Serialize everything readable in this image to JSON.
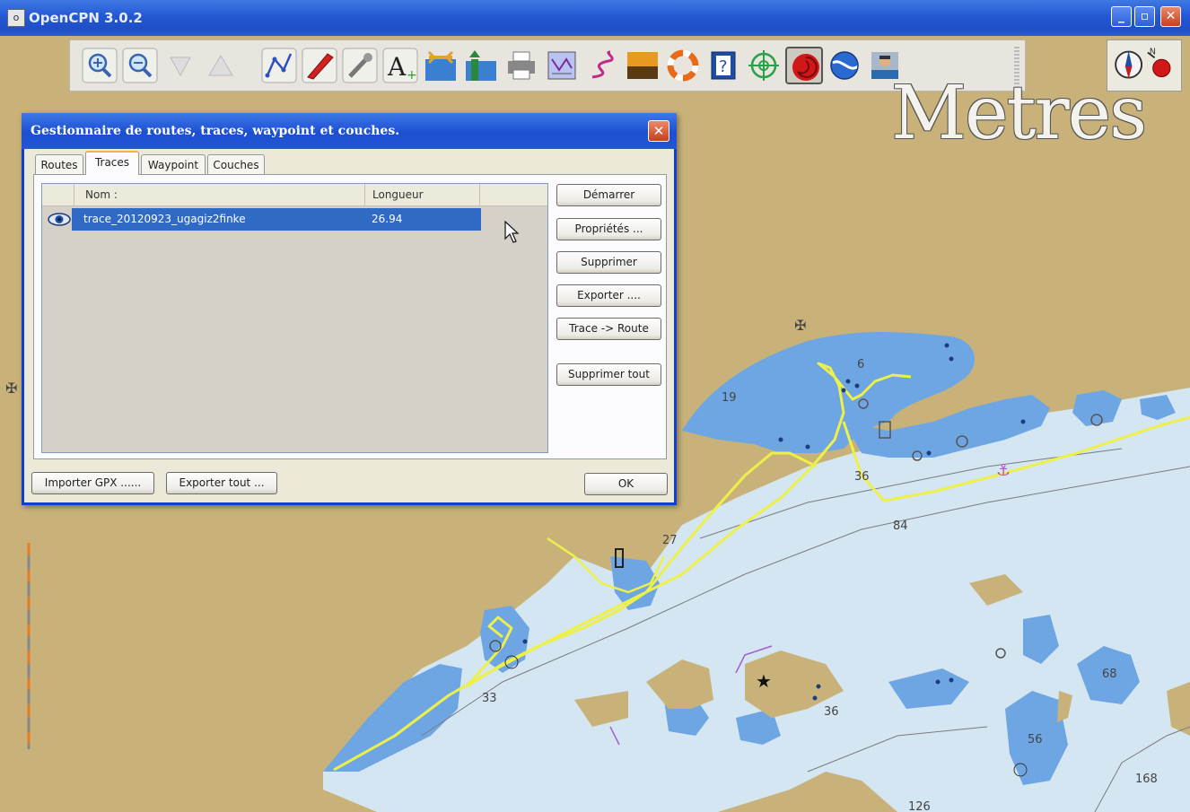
{
  "window": {
    "title": "OpenCPN 3.0.2",
    "minimize": "_",
    "maximize": "▫",
    "close": "✕"
  },
  "toolbar": {
    "tools": [
      "zoom-in-icon",
      "zoom-out-icon",
      "scale-in-icon",
      "scale-out-icon",
      "route-icon",
      "ship-follow-icon",
      "settings-wrench-icon",
      "text-icon",
      "chart-quilt-icon",
      "tide-current-icon",
      "print-icon",
      "route-manager-icon",
      "track-icon",
      "day-night-icon",
      "lifebuoy-icon",
      "about-icon",
      "mob-icon",
      "record-track-icon",
      "globe-icon",
      "pirate-icon"
    ],
    "active_tool": "record-track-icon"
  },
  "map": {
    "scale_unit_text": "Metres",
    "soundings": [
      "6",
      "19",
      "36",
      "84",
      "27",
      "33",
      "36",
      "68",
      "56",
      "168",
      "126"
    ]
  },
  "dialog": {
    "title": "Gestionnaire de routes, traces, waypoint et couches.",
    "close": "✕",
    "tabs": [
      "Routes",
      "Traces",
      "Waypoint",
      "Couches"
    ],
    "selected_tab": "Traces",
    "columns": {
      "name": "Nom :",
      "length": "Longueur"
    },
    "rows": [
      {
        "name": "trace_20120923_ugagiz2finke",
        "length": "26.94",
        "visible": true,
        "selected": true
      }
    ],
    "side_buttons": {
      "start": "Démarrer",
      "properties": "Propriétés ...",
      "delete": "Supprimer",
      "export": "Exporter ....",
      "to_route": "Trace -> Route",
      "delete_all": "Supprimer tout"
    },
    "bottom_buttons": {
      "import_gpx": "Importer GPX ......",
      "export_all": "Exporter tout ...",
      "ok": "OK"
    }
  },
  "colors": {
    "land": "#c9b27a",
    "shallow_water": "#d4e6f1",
    "deep_water": "#6ea6e3",
    "track": "#eef04a",
    "titlebar": "#2457d4",
    "selection": "#316ac5"
  }
}
